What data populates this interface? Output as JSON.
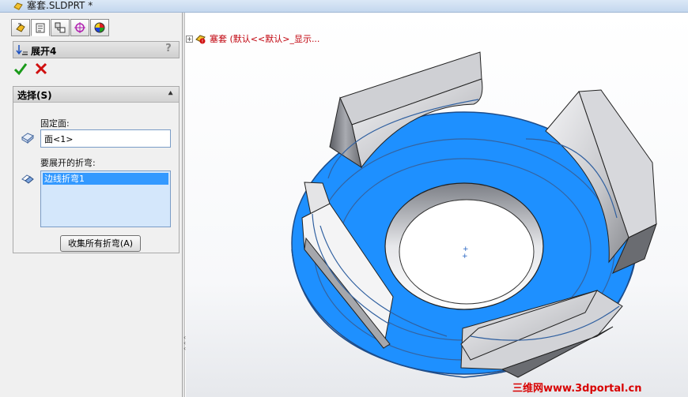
{
  "window": {
    "title": "塞套.SLDPRT *"
  },
  "tabs": [
    {
      "name": "featuremanager-tab",
      "icon": "feature-tree-icon"
    },
    {
      "name": "propertymanager-tab",
      "icon": "property-manager-icon"
    },
    {
      "name": "configurationmanager-tab",
      "icon": "configuration-icon"
    },
    {
      "name": "dimxpert-tab",
      "icon": "target-icon"
    },
    {
      "name": "display-manager-tab",
      "icon": "color-wheel-icon"
    }
  ],
  "property_manager": {
    "title": "展开4",
    "help": "?",
    "selection_group": {
      "title": "选择(S)",
      "fixed_face_label": "固定面:",
      "fixed_face_value": "面<1>",
      "bends_label": "要展开的折弯:",
      "bends": [
        "边线折弯1"
      ],
      "collect_button": "收集所有折弯(A)"
    }
  },
  "feature_tree": {
    "expander": "+",
    "item_label": "塞套 (默认<<默认>_显示..."
  },
  "watermark": "三维网www.3dportal.cn",
  "colors": {
    "selected_face": "#1e90ff",
    "tree_text": "#c0000b",
    "watermark": "#d80000"
  }
}
